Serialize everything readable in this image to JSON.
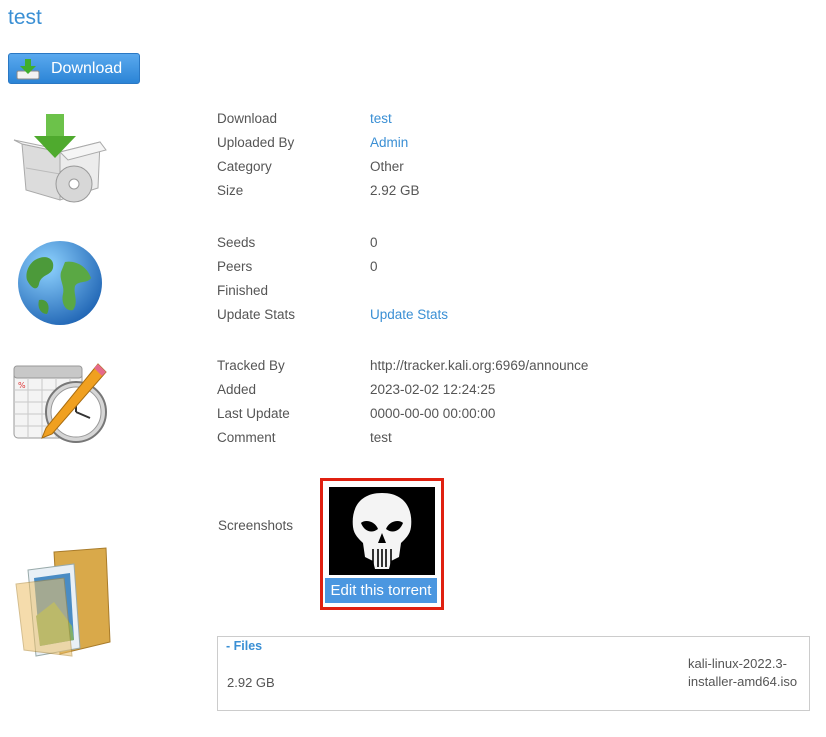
{
  "page": {
    "title": "test",
    "download_button": "Download"
  },
  "info": {
    "download": {
      "label": "Download",
      "value": "test"
    },
    "uploaded_by": {
      "label": "Uploaded By",
      "value": "Admin"
    },
    "category": {
      "label": "Category",
      "value": "Other"
    },
    "size": {
      "label": "Size",
      "value": "2.92 GB"
    }
  },
  "stats": {
    "seeds": {
      "label": "Seeds",
      "value": "0"
    },
    "peers": {
      "label": "Peers",
      "value": "0"
    },
    "finished": {
      "label": "Finished",
      "value": ""
    },
    "update_stats": {
      "label": "Update Stats",
      "value": "Update Stats"
    }
  },
  "tracking": {
    "tracked_by": {
      "label": "Tracked By",
      "value": "http://tracker.kali.org:6969/announce"
    },
    "added": {
      "label": "Added",
      "value": "2023-02-02 12:24:25"
    },
    "last_update": {
      "label": "Last Update",
      "value": "0000-00-00 00:00:00"
    },
    "comment": {
      "label": "Comment",
      "value": "test"
    }
  },
  "screenshots": {
    "label": "Screenshots",
    "edit_button": "Edit this torrent"
  },
  "files": {
    "header": "- Files",
    "size": "2.92 GB",
    "name": "kali-linux-2022.3-installer-amd64.iso"
  },
  "colors": {
    "link": "#3a8fd4",
    "highlight_border": "#e02010",
    "button": "#4b97e0"
  }
}
